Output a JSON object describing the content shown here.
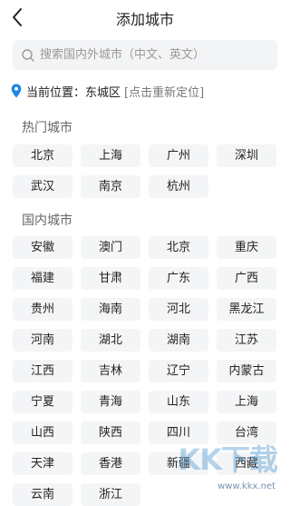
{
  "header": {
    "title": "添加城市",
    "back_icon": "chevron-left-icon"
  },
  "search": {
    "placeholder": "搜索国内外城市（中文、英文）",
    "value": "",
    "icon": "search-icon"
  },
  "location": {
    "icon": "location-pin-icon",
    "text": "当前位置：东城区",
    "action": "[点击重新定位]",
    "accent": "#1e88e5"
  },
  "hot": {
    "label": "热门城市",
    "cities": [
      "北京",
      "上海",
      "广州",
      "深圳",
      "武汉",
      "南京",
      "杭州"
    ]
  },
  "domestic": {
    "label": "国内城市",
    "cities": [
      "安徽",
      "澳门",
      "北京",
      "重庆",
      "福建",
      "甘肃",
      "广东",
      "广西",
      "贵州",
      "海南",
      "河北",
      "黑龙江",
      "河南",
      "湖北",
      "湖南",
      "江苏",
      "江西",
      "吉林",
      "辽宁",
      "内蒙古",
      "宁夏",
      "青海",
      "山东",
      "上海",
      "山西",
      "陕西",
      "四川",
      "台湾",
      "天津",
      "香港",
      "新疆",
      "西藏",
      "云南",
      "浙江"
    ]
  },
  "watermark": {
    "logo": "KK下载",
    "url": "www.kkx.net"
  }
}
